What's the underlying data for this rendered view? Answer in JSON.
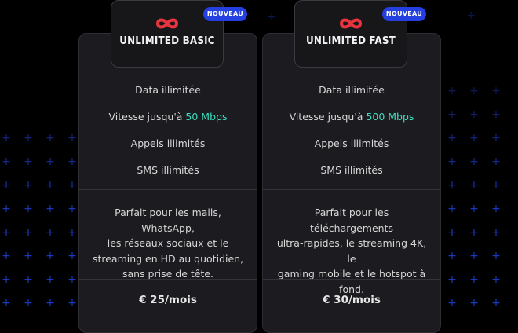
{
  "colors": {
    "background": "#000000",
    "card": "#1c1c20",
    "accent_speed": "#3ddcc0",
    "badge": "#2540e0",
    "logo": "#e8343e",
    "grid_plus": "#1f3fd9"
  },
  "plans": [
    {
      "logo_icon": "infinity-icon",
      "title": "UNLIMITED BASIC",
      "badge": "NOUVEAU",
      "features": {
        "data": "Data illimitée",
        "speed_prefix": "Vitesse jusqu'à ",
        "speed_value": "50 Mbps",
        "calls": "Appels illimités",
        "sms": "SMS illimités"
      },
      "description_lines": [
        "Parfait pour les mails, WhatsApp,",
        "les réseaux sociaux et le",
        "streaming en HD au quotidien,",
        "sans prise de tête."
      ],
      "price": "€ 25/mois"
    },
    {
      "logo_icon": "infinity-icon",
      "title": "UNLIMITED FAST",
      "badge": "NOUVEAU",
      "features": {
        "data": "Data illimitée",
        "speed_prefix": "Vitesse jusqu'à ",
        "speed_value": "500 Mbps",
        "calls": "Appels illimités",
        "sms": "SMS illimités"
      },
      "description_lines": [
        "Parfait pour les téléchargements",
        "ultra-rapides, le streaming 4K, le",
        "gaming mobile et le hotspot à",
        "fond."
      ],
      "price": "€ 30/mois"
    }
  ]
}
